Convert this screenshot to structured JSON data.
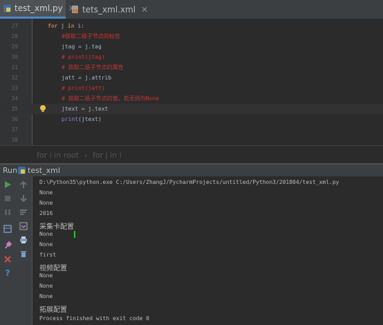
{
  "tabs": [
    {
      "label": "test_xml.py",
      "active": true
    },
    {
      "label": "tets_xml.xml",
      "active": false
    }
  ],
  "editor": {
    "lines": [
      {
        "n": "27",
        "parts": [
          {
            "t": "for",
            "c": "kw"
          },
          {
            "t": " j ",
            "c": ""
          },
          {
            "t": "in",
            "c": "kw"
          },
          {
            "t": " i:",
            "c": ""
          }
        ]
      },
      {
        "n": "28",
        "parts": [
          {
            "t": "#获取二级子节点的标签",
            "c": "cm"
          }
        ]
      },
      {
        "n": "29",
        "parts": [
          {
            "t": "jtag = j.tag",
            "c": ""
          }
        ]
      },
      {
        "n": "30",
        "parts": [
          {
            "t": "# print(jtag)",
            "c": "cm"
          }
        ]
      },
      {
        "n": "31",
        "parts": [
          {
            "t": "# 获取二级子节点的属性",
            "c": "cm"
          }
        ]
      },
      {
        "n": "32",
        "parts": [
          {
            "t": "jatt = j.attrib",
            "c": ""
          }
        ]
      },
      {
        "n": "33",
        "parts": [
          {
            "t": "# print(jatt)",
            "c": "cm"
          }
        ]
      },
      {
        "n": "34",
        "parts": [
          {
            "t": "# 获取二级子节点的值，若无则为None",
            "c": "cm"
          }
        ]
      },
      {
        "n": "35",
        "parts": [
          {
            "t": "jtext = j.text",
            "c": ""
          }
        ]
      },
      {
        "n": "36",
        "parts": [
          {
            "t": "print",
            "c": "fn"
          },
          {
            "t": "(jtext)",
            "c": ""
          }
        ]
      },
      {
        "n": "37",
        "parts": []
      },
      {
        "n": "38",
        "parts": []
      }
    ]
  },
  "breadcrumb": {
    "item1": "for i in root",
    "sep": "›",
    "item2": "for j in i"
  },
  "run": {
    "label": "Run",
    "config": "test_xml"
  },
  "console": {
    "command": "D:\\Python35\\python.exe C:/Users/ZhangJ/PycharmProjects/untitled/Python3/201804/test_xml.py",
    "output": [
      "None",
      "None",
      "2016",
      "采集卡配置",
      "None",
      "None",
      "first",
      "视频配置",
      "None",
      "None",
      "None",
      "拓展配置"
    ],
    "exit": "Process finished with exit code 0"
  },
  "colors": {
    "accent": "#4a88c7",
    "run_green": "#499c54",
    "stop_red": "#c75450"
  }
}
